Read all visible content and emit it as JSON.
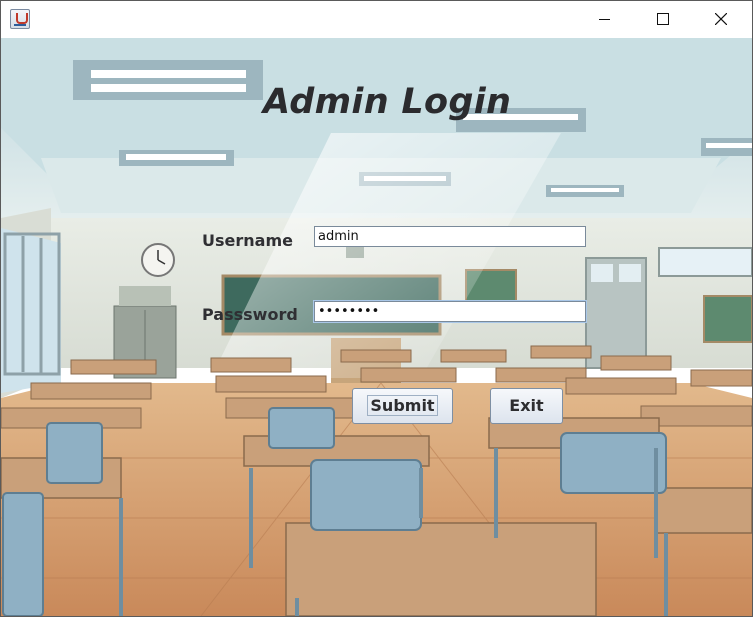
{
  "window": {
    "app_icon": "java-cup-icon",
    "controls": [
      "minimize-icon",
      "maximize-icon",
      "close-icon"
    ]
  },
  "form": {
    "title": "Admin Login",
    "username_label": "Username",
    "username_value": "admin",
    "password_label": "Passsword",
    "password_value": "••••••••",
    "submit_label": "Submit",
    "exit_label": "Exit"
  },
  "colors": {
    "title_text": "#2b2b2e",
    "label_text": "#2f2f33",
    "button_face": "#e6ebf2",
    "field_border": "#7a8a9a"
  }
}
